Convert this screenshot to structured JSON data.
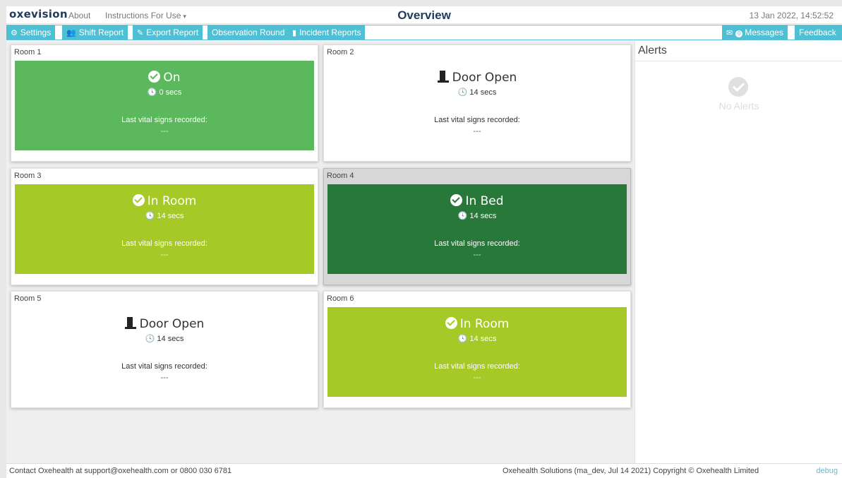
{
  "header": {
    "logo": "oxevision",
    "about": "About",
    "instructions": "Instructions For Use",
    "title": "Overview",
    "datetime": "13 Jan 2022, 14:52:52"
  },
  "toolbar": {
    "settings": "Settings",
    "shift_report": "Shift Report",
    "export_report": "Export Report",
    "observation_round": "Observation Round",
    "incident_reports": "Incident Reports",
    "messages": "Messages",
    "messages_count": "0",
    "feedback": "Feedback"
  },
  "rooms": [
    {
      "name": "Room 1",
      "status": "On",
      "elapsed": "0 secs",
      "vitals_label": "Last vital signs recorded:",
      "vitals_value": "---",
      "color": "#5cb85c",
      "icon": "check-circle-icon"
    },
    {
      "name": "Room 2",
      "status": "Door Open",
      "elapsed": "14 secs",
      "vitals_label": "Last vital signs recorded:",
      "vitals_value": "---",
      "color": "#ffffff",
      "icon": "door-open-icon"
    },
    {
      "name": "Room 3",
      "status": "In Room",
      "elapsed": "14 secs",
      "vitals_label": "Last vital signs recorded:",
      "vitals_value": "---",
      "color": "#a5c927",
      "icon": "check-circle-icon"
    },
    {
      "name": "Room 4",
      "status": "In Bed",
      "elapsed": "14 secs",
      "vitals_label": "Last vital signs recorded:",
      "vitals_value": "---",
      "color": "#28783a",
      "icon": "check-circle-icon"
    },
    {
      "name": "Room 5",
      "status": "Door Open",
      "elapsed": "14 secs",
      "vitals_label": "Last vital signs recorded:",
      "vitals_value": "---",
      "color": "#ffffff",
      "icon": "door-open-icon"
    },
    {
      "name": "Room 6",
      "status": "In Room",
      "elapsed": "14 secs",
      "vitals_label": "Last vital signs recorded:",
      "vitals_value": "---",
      "color": "#a5c927",
      "icon": "check-circle-icon"
    }
  ],
  "alerts": {
    "title": "Alerts",
    "empty_text": "No Alerts"
  },
  "footer": {
    "contact": "Contact Oxehealth at support@oxehealth.com or 0800 030 6781",
    "copyright": "Oxehealth Solutions (ma_dev, Jul 14 2021) Copyright © Oxehealth Limited",
    "debug": "debug"
  }
}
